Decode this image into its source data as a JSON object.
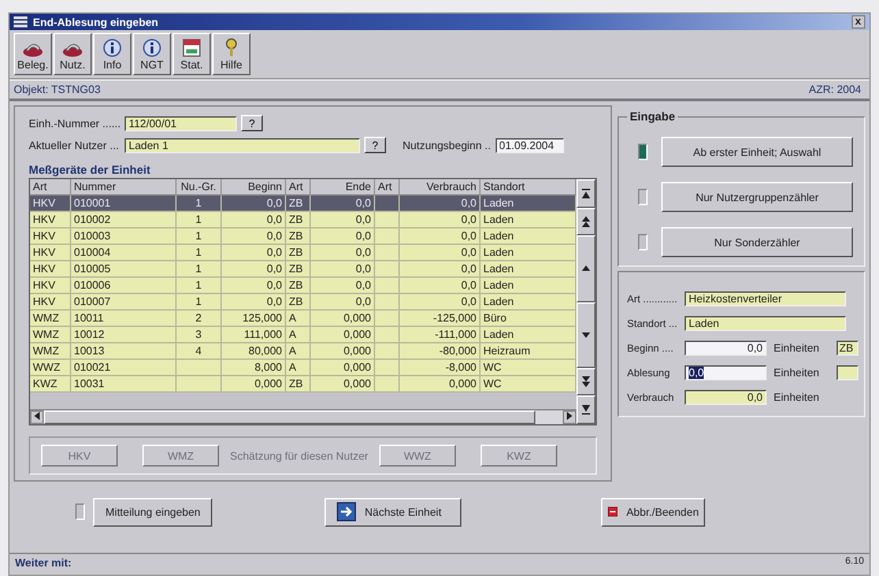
{
  "window": {
    "title": "End-Ablesung eingeben",
    "close": "x"
  },
  "toolbar": [
    {
      "label": "Beleg."
    },
    {
      "label": "Nutz."
    },
    {
      "label": "Info"
    },
    {
      "label": "NGT"
    },
    {
      "label": "Stat."
    },
    {
      "label": "Hilfe"
    }
  ],
  "object_bar": {
    "object": "Objekt: TSTNG03",
    "period": "AZR: 2004"
  },
  "unit": {
    "number_label": "Einh.-Nummer ......",
    "number": "112/00/01",
    "lookup": "?",
    "user_label": "Aktueller Nutzer ...",
    "user": "Laden 1",
    "user_lookup": "?",
    "start_label": "Nutzungsbeginn ..",
    "start": "01.09.2004"
  },
  "table": {
    "title": "Meßgeräte der Einheit",
    "columns": [
      "Art",
      "Nummer",
      "Nu.-Gr.",
      "Beginn",
      "Art",
      "Ende",
      "Art",
      "Verbrauch",
      "Standort"
    ],
    "rows": [
      {
        "selected": true,
        "cells": [
          "HKV",
          "010001",
          "1",
          "0,0",
          "ZB",
          "0,0",
          "",
          "0,0",
          "Laden"
        ]
      },
      {
        "selected": false,
        "cells": [
          "HKV",
          "010002",
          "1",
          "0,0",
          "ZB",
          "0,0",
          "",
          "0,0",
          "Laden"
        ]
      },
      {
        "selected": false,
        "cells": [
          "HKV",
          "010003",
          "1",
          "0,0",
          "ZB",
          "0,0",
          "",
          "0,0",
          "Laden"
        ]
      },
      {
        "selected": false,
        "cells": [
          "HKV",
          "010004",
          "1",
          "0,0",
          "ZB",
          "0,0",
          "",
          "0,0",
          "Laden"
        ]
      },
      {
        "selected": false,
        "cells": [
          "HKV",
          "010005",
          "1",
          "0,0",
          "ZB",
          "0,0",
          "",
          "0,0",
          "Laden"
        ]
      },
      {
        "selected": false,
        "cells": [
          "HKV",
          "010006",
          "1",
          "0,0",
          "ZB",
          "0,0",
          "",
          "0,0",
          "Laden"
        ]
      },
      {
        "selected": false,
        "cells": [
          "HKV",
          "010007",
          "1",
          "0,0",
          "ZB",
          "0,0",
          "",
          "0,0",
          "Laden"
        ]
      },
      {
        "selected": false,
        "cells": [
          "WMZ",
          "10011",
          "2",
          "125,000",
          "A",
          "0,000",
          "",
          "-125,000",
          "Büro"
        ]
      },
      {
        "selected": false,
        "cells": [
          "WMZ",
          "10012",
          "3",
          "111,000",
          "A",
          "0,000",
          "",
          "-111,000",
          "Laden"
        ]
      },
      {
        "selected": false,
        "cells": [
          "WMZ",
          "10013",
          "4",
          "80,000",
          "A",
          "0,000",
          "",
          "-80,000",
          "Heizraum"
        ]
      },
      {
        "selected": false,
        "cells": [
          "WWZ",
          "010021",
          "",
          "8,000",
          "A",
          "0,000",
          "",
          "-8,000",
          "WC"
        ]
      },
      {
        "selected": false,
        "cells": [
          "KWZ",
          "10031",
          "",
          "0,000",
          "ZB",
          "0,000",
          "",
          "0,000",
          "WC"
        ]
      }
    ]
  },
  "estimate": {
    "label": "Schätzung für diesen Nutzer",
    "buttons": [
      {
        "label": "HKV",
        "disabled": true
      },
      {
        "label": "WMZ",
        "disabled": true
      },
      {
        "label": "WWZ",
        "disabled": true
      },
      {
        "label": "KWZ",
        "disabled": true
      }
    ]
  },
  "input_group": {
    "title": "Eingabe",
    "options": [
      {
        "label": "Ab erster Einheit; Auswahl",
        "active": true
      },
      {
        "label": "Nur Nutzergruppenzähler",
        "active": false
      },
      {
        "label": "Nur Sonderzähler",
        "active": false
      }
    ]
  },
  "details": {
    "type_label": "Art ............",
    "type": "Heizkostenverteiler",
    "location_label": "Standort ...",
    "location": "Laden",
    "start_label": "Beginn ....",
    "start": "0,0",
    "start_unit": "Einheiten",
    "start_code": "ZB",
    "reading_label": "Ablesung",
    "reading": "0,0",
    "reading_unit": "Einheiten",
    "usage_label": "Verbrauch",
    "usage": "0,0",
    "usage_unit": "Einheiten"
  },
  "actions": {
    "message": {
      "label": "Mitteilung eingeben",
      "flag": false
    },
    "next": "Nächste Einheit",
    "cancel": "Abbr./Beenden"
  },
  "status_bar": {
    "text": "Weiter mit:",
    "version": "6.10"
  }
}
